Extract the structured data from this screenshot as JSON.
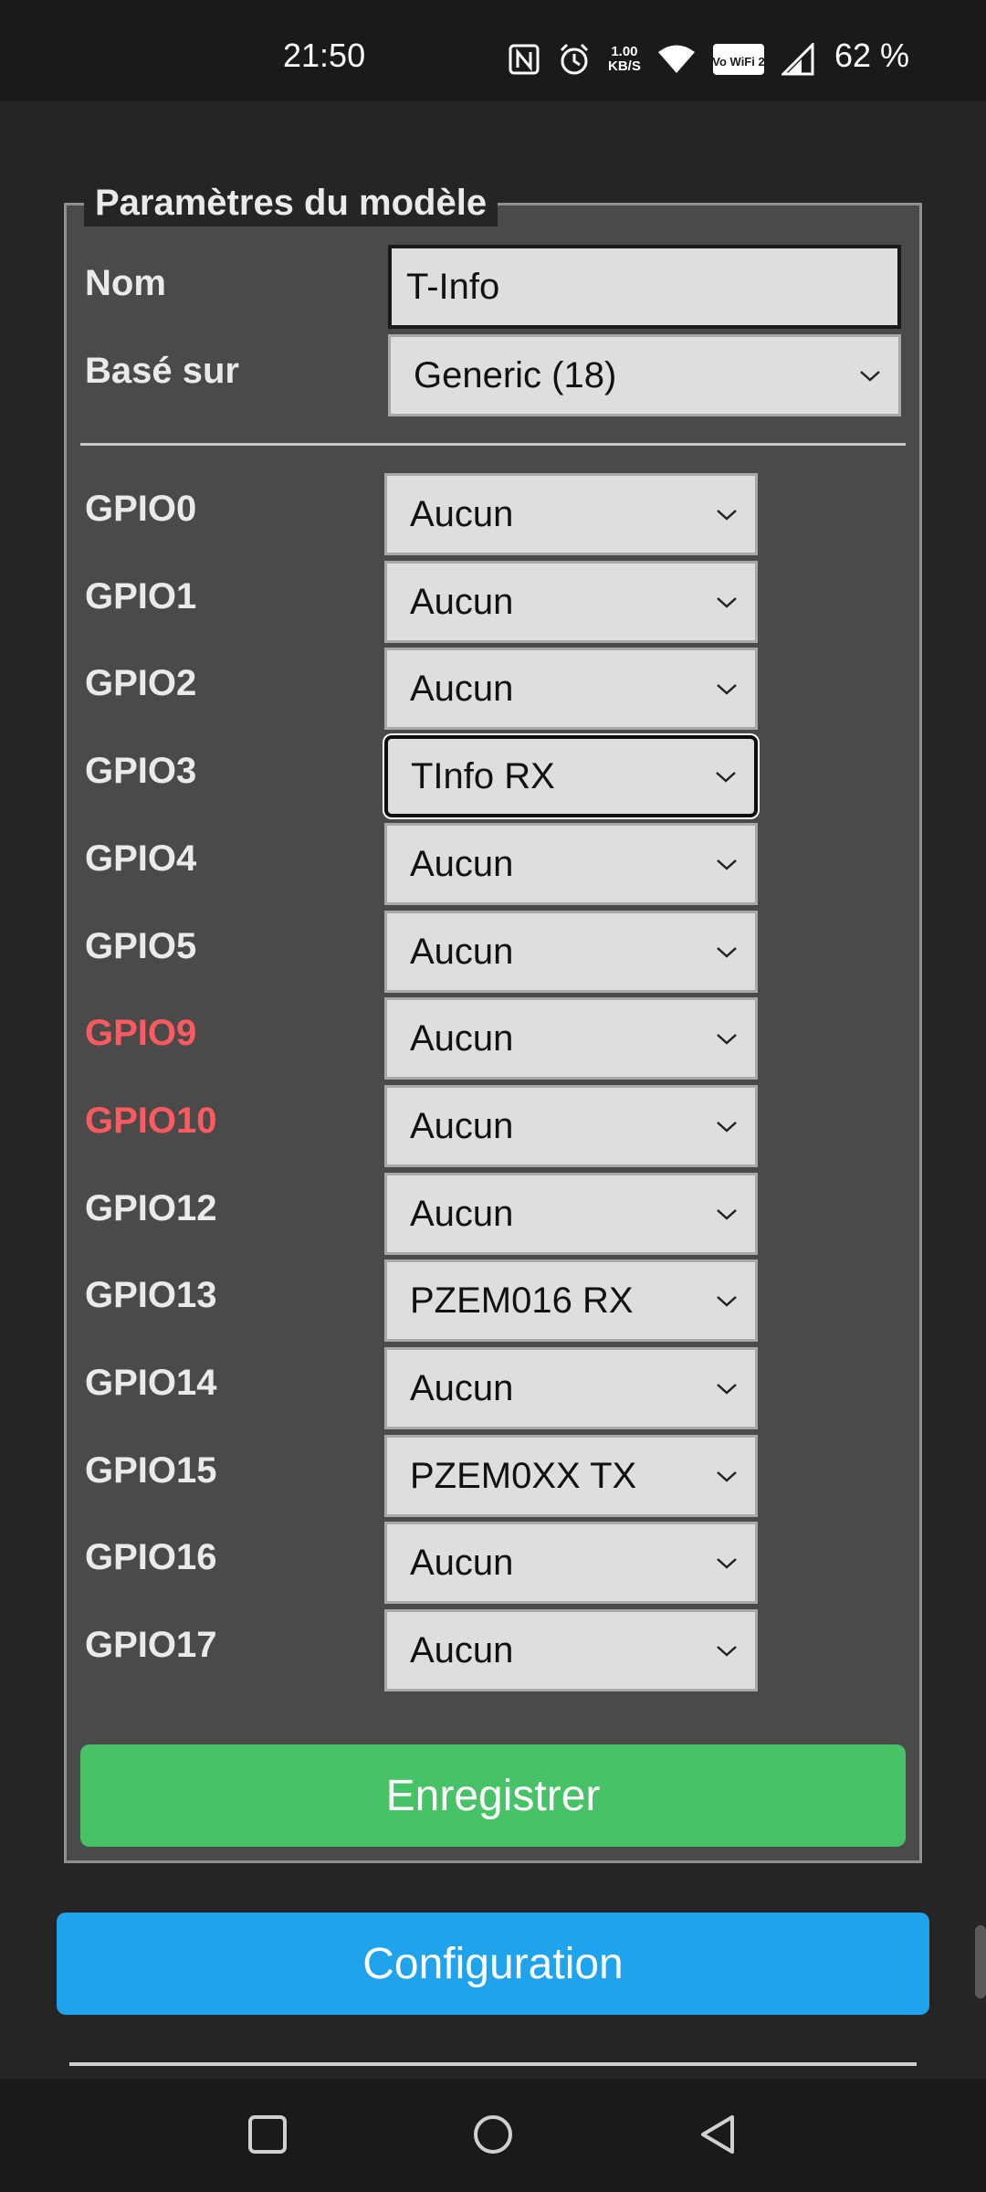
{
  "status_bar": {
    "time": "21:50",
    "net_speed_value": "1.00",
    "net_speed_unit": "KB/S",
    "wifi_label": "Vo WiFi 2",
    "battery": "62 %",
    "icons": [
      "nfc-icon",
      "alarm-icon",
      "wifi-icon",
      "vowifi-icon",
      "signal-icon"
    ]
  },
  "form": {
    "legend": "Paramètres du modèle",
    "name_label": "Nom",
    "name_value": "T-Info",
    "based_on_label": "Basé sur",
    "based_on_value": "Generic (18)"
  },
  "gpio_rows": [
    {
      "label": "GPIO0",
      "value": "Aucun",
      "warn": false
    },
    {
      "label": "GPIO1",
      "value": "Aucun",
      "warn": false
    },
    {
      "label": "GPIO2",
      "value": "Aucun",
      "warn": false
    },
    {
      "label": "GPIO3",
      "value": "TInfo RX",
      "warn": false,
      "focused": true
    },
    {
      "label": "GPIO4",
      "value": "Aucun",
      "warn": false
    },
    {
      "label": "GPIO5",
      "value": "Aucun",
      "warn": false
    },
    {
      "label": "GPIO9",
      "value": "Aucun",
      "warn": true
    },
    {
      "label": "GPIO10",
      "value": "Aucun",
      "warn": true
    },
    {
      "label": "GPIO12",
      "value": "Aucun",
      "warn": false
    },
    {
      "label": "GPIO13",
      "value": "PZEM016 RX",
      "warn": false
    },
    {
      "label": "GPIO14",
      "value": "Aucun",
      "warn": false
    },
    {
      "label": "GPIO15",
      "value": "PZEM0XX TX",
      "warn": false
    },
    {
      "label": "GPIO16",
      "value": "Aucun",
      "warn": false
    },
    {
      "label": "GPIO17",
      "value": "Aucun",
      "warn": false
    }
  ],
  "buttons": {
    "save": "Enregistrer",
    "configuration": "Configuration"
  },
  "colors": {
    "save_button": "#47c266",
    "config_button": "#1fa3ec",
    "warn_label": "#ff5a5f"
  }
}
